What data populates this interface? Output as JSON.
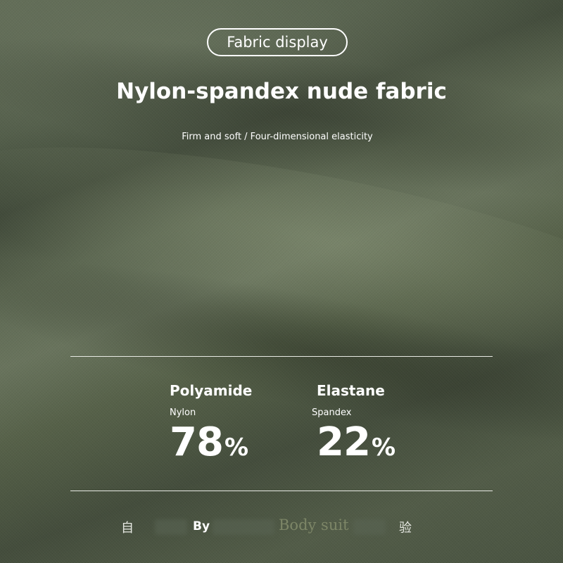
{
  "badge": {
    "label": "Fabric display"
  },
  "heading": {
    "title": "Nylon-spandex nude fabric",
    "subtitle": "Firm and soft / Four-dimensional elasticity"
  },
  "composition": [
    {
      "name": "Polyamide",
      "alias": "Nylon",
      "percent": "78",
      "unit": "%"
    },
    {
      "name": "Elastane",
      "alias": "Spandex",
      "percent": "22",
      "unit": "%"
    }
  ],
  "footer": {
    "left_glyph": "自",
    "by": "By",
    "brand": "Body suit",
    "right_glyph": "验"
  },
  "colors": {
    "fabric": "#4f5a47",
    "text": "#ffffff",
    "brand": "#7d8667"
  }
}
